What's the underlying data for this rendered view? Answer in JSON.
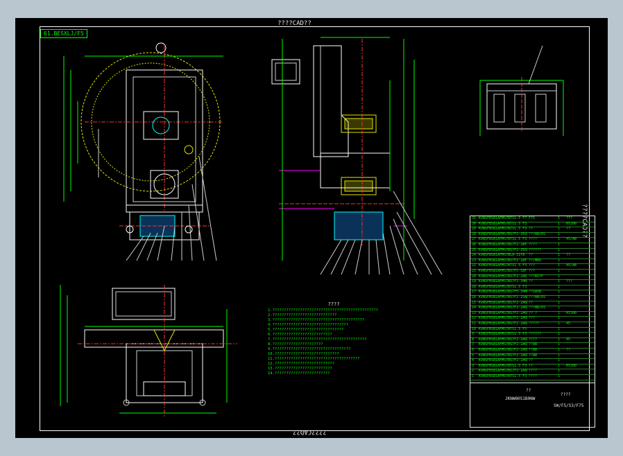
{
  "drawing": {
    "title_top": "????CAD??",
    "title_bottom": "????CAD??",
    "title_right": "????CAD??",
    "corner_code": "61.BESXLJ/F5"
  },
  "notes": {
    "heading": "????",
    "lines": [
      "1.??????????????????????????????????????????????",
      "2.????????????????????????????",
      "3.????????????????????????????????????????",
      "4.?????????????????????????????????",
      "5.???????????????????????????????",
      "6.??????????????????????????",
      "7.?????????????????????????????????????????",
      "8.??????????????????????",
      "9.??????????????????????????????????",
      "10.????????????????????????????",
      "11.?????????????????????????????????????",
      "12.??????????????????????????",
      "13.?????????????????????????",
      "14.????????????????????????"
    ]
  },
  "bom": {
    "rows": [
      {
        "no": "31",
        "code": "KVNSFBSB1AFMS7BTS1.5 F75",
        "name": "F75",
        "qty": "1",
        "note": "???"
      },
      {
        "no": "30",
        "code": "KVNSFBSB1AFMS7BTS1.5 F3.3",
        "name": "",
        "qty": "1",
        "note": "HT200"
      },
      {
        "no": "29",
        "code": "KVNSFBSB1AFMS7BTS1.5 F3.3",
        "name": "??",
        "qty": "1",
        "note": "??"
      },
      {
        "no": "28",
        "code": "KVNSFBSB1AFMS7BS7F2-26SB",
        "name": "???AB/DS",
        "qty": "1",
        "note": ""
      },
      {
        "no": "27",
        "code": "KVNSFBSB1AFMS7BTS1.5 F3.3",
        "name": "????",
        "qty": "1",
        "note": "45/AB"
      },
      {
        "no": "26",
        "code": "KVNSFBSB1AFMS7BS7F2-2AF2",
        "name": "????",
        "qty": "1",
        "note": ""
      },
      {
        "no": "25",
        "code": "KVNSFBSB1AFMS7BS7F2-26SB",
        "name": "??????",
        "qty": "1",
        "note": ""
      },
      {
        "no": "24",
        "code": "KVNSFBSB1AFMS7BLA-31TB",
        "name": "??",
        "qty": "1",
        "note": "??"
      },
      {
        "no": "23",
        "code": "KVNSFBSB1AFMS7BS7F2-2AF1",
        "name": "??/MRD",
        "qty": "1",
        "note": ""
      },
      {
        "no": "22",
        "code": "KVNSFBSB1AFMS7BTS1.5 F3.3",
        "name": "???",
        "qty": "1",
        "note": "45/AB"
      },
      {
        "no": "21",
        "code": "KVNSFBSB1AFMS7BS7F5-S8F",
        "name": "???",
        "qty": "1",
        "note": ""
      },
      {
        "no": "20",
        "code": "KVNSFBSB1AFMS7BS7F2-2A6",
        "name": "???BS7F",
        "qty": "1",
        "note": ""
      },
      {
        "no": "19",
        "code": "KVNSFBSB1AFMS7BS7F2-34MA",
        "name": "??",
        "qty": "1",
        "note": "???"
      },
      {
        "no": "18",
        "code": "KVNSFBSB1AFMS7BTS1.5 F3.8",
        "name": "",
        "qty": "1",
        "note": ""
      },
      {
        "no": "17",
        "code": "KVNSFBSB1AFMS7BS7F5-34MB",
        "name": "??SA5B",
        "qty": "1",
        "note": ""
      },
      {
        "no": "16",
        "code": "KVNSFBSB1AFMS7BS7F2-2SAD",
        "name": "???AB/DS",
        "qty": "1",
        "note": ""
      },
      {
        "no": "15",
        "code": "KVNSFBSB1AFMS7BS7F2-2A6B",
        "name": "??",
        "qty": "1",
        "note": ""
      },
      {
        "no": "14",
        "code": "KVNSFBSB1AFMS7BS7F2-2A6B",
        "name": "???AB/DS",
        "qty": "1",
        "note": ""
      },
      {
        "no": "13",
        "code": "KVNSFBSB1AFMS7BS7F2-2A6B",
        "name": "?? ?",
        "qty": "1",
        "note": "HT200"
      },
      {
        "no": "12",
        "code": "KVNSFBSB1AFMS7BS7F2-2A6B",
        "name": "???",
        "qty": "1",
        "note": ""
      },
      {
        "no": "11",
        "code": "KVNSFBSB1AFMS7BS7F2-2A6B",
        "name": "?????",
        "qty": "1",
        "note": "45"
      },
      {
        "no": "10",
        "code": "KVNSFBSB1AFMS7BTS1.5 F3.3",
        "name": "",
        "qty": "1",
        "note": ""
      },
      {
        "no": "9",
        "code": "KVNSFBSB1AFMS7BTS1.5 F3.3",
        "name": "??????",
        "qty": "1",
        "note": ""
      },
      {
        "no": "8",
        "code": "KVNSFBSB1AFMS7BS7F2-2A6B",
        "name": "????",
        "qty": "1",
        "note": "45"
      },
      {
        "no": "7",
        "code": "KVNSFBSB1AFMS7BS7F2-2A6B",
        "name": "??AB",
        "qty": "1",
        "note": ""
      },
      {
        "no": "6",
        "code": "KVNSFBSB1AFMS7BS7F2-2A6B",
        "name": "??AB",
        "qty": "1",
        "note": "??"
      },
      {
        "no": "5",
        "code": "KVNSFBSB1AFMS7BS7F2-2A6B",
        "name": "??AB",
        "qty": "1",
        "note": ""
      },
      {
        "no": "4",
        "code": "KVNSFBSB1AFMS7BS7F2-2A6B",
        "name": "??",
        "qty": "1",
        "note": ""
      },
      {
        "no": "3",
        "code": "KVNSFBSB1AFMS7BTS1.5 F3.3",
        "name": "??",
        "qty": "1",
        "note": "HT200"
      },
      {
        "no": "2",
        "code": "KVNSFBSB1AFMS7BS7F2-2A6B",
        "name": "????",
        "qty": "1",
        "note": ""
      },
      {
        "no": "1",
        "code": "KVNSFBSB1AFMS7BTS1.5 F3.3",
        "name": "????",
        "qty": "1",
        "note": ""
      }
    ],
    "title_block": {
      "name": "??",
      "code": "JKNW80S1B0NW",
      "company": "????",
      "sheet": "SW/F5/S3/F75"
    }
  }
}
